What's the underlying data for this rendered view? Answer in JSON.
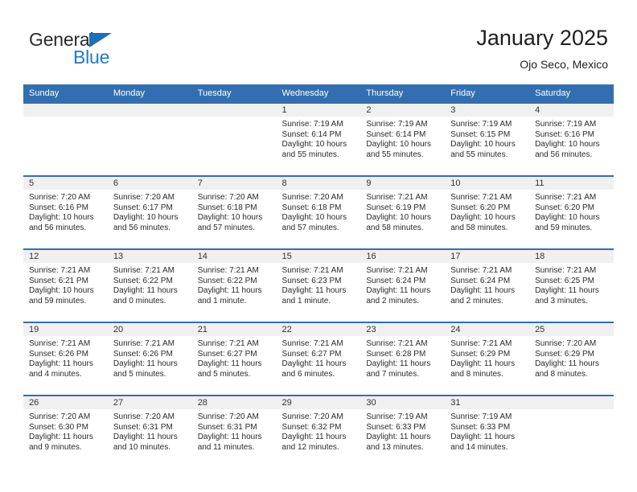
{
  "brand": {
    "name_top": "General",
    "name_bottom": "Blue",
    "triangle_color": "#1f6fb5",
    "text_color": "#2b2b2b",
    "blue_color": "#2079c7"
  },
  "header": {
    "title": "January 2025",
    "subtitle": "Ojo Seco, Mexico"
  },
  "theme": {
    "header_blue": "#336fb0",
    "daynum_band": "#f0f0f0",
    "text": "#2a2a2a"
  },
  "weekdays": [
    "Sunday",
    "Monday",
    "Tuesday",
    "Wednesday",
    "Thursday",
    "Friday",
    "Saturday"
  ],
  "weeks": [
    [
      {
        "day": "",
        "sunrise": "",
        "sunset": "",
        "daylight_line1": "",
        "daylight_line2": ""
      },
      {
        "day": "",
        "sunrise": "",
        "sunset": "",
        "daylight_line1": "",
        "daylight_line2": ""
      },
      {
        "day": "",
        "sunrise": "",
        "sunset": "",
        "daylight_line1": "",
        "daylight_line2": ""
      },
      {
        "day": "1",
        "sunrise": "Sunrise: 7:19 AM",
        "sunset": "Sunset: 6:14 PM",
        "daylight_line1": "Daylight: 10 hours",
        "daylight_line2": "and 55 minutes."
      },
      {
        "day": "2",
        "sunrise": "Sunrise: 7:19 AM",
        "sunset": "Sunset: 6:14 PM",
        "daylight_line1": "Daylight: 10 hours",
        "daylight_line2": "and 55 minutes."
      },
      {
        "day": "3",
        "sunrise": "Sunrise: 7:19 AM",
        "sunset": "Sunset: 6:15 PM",
        "daylight_line1": "Daylight: 10 hours",
        "daylight_line2": "and 55 minutes."
      },
      {
        "day": "4",
        "sunrise": "Sunrise: 7:19 AM",
        "sunset": "Sunset: 6:16 PM",
        "daylight_line1": "Daylight: 10 hours",
        "daylight_line2": "and 56 minutes."
      }
    ],
    [
      {
        "day": "5",
        "sunrise": "Sunrise: 7:20 AM",
        "sunset": "Sunset: 6:16 PM",
        "daylight_line1": "Daylight: 10 hours",
        "daylight_line2": "and 56 minutes."
      },
      {
        "day": "6",
        "sunrise": "Sunrise: 7:20 AM",
        "sunset": "Sunset: 6:17 PM",
        "daylight_line1": "Daylight: 10 hours",
        "daylight_line2": "and 56 minutes."
      },
      {
        "day": "7",
        "sunrise": "Sunrise: 7:20 AM",
        "sunset": "Sunset: 6:18 PM",
        "daylight_line1": "Daylight: 10 hours",
        "daylight_line2": "and 57 minutes."
      },
      {
        "day": "8",
        "sunrise": "Sunrise: 7:20 AM",
        "sunset": "Sunset: 6:18 PM",
        "daylight_line1": "Daylight: 10 hours",
        "daylight_line2": "and 57 minutes."
      },
      {
        "day": "9",
        "sunrise": "Sunrise: 7:21 AM",
        "sunset": "Sunset: 6:19 PM",
        "daylight_line1": "Daylight: 10 hours",
        "daylight_line2": "and 58 minutes."
      },
      {
        "day": "10",
        "sunrise": "Sunrise: 7:21 AM",
        "sunset": "Sunset: 6:20 PM",
        "daylight_line1": "Daylight: 10 hours",
        "daylight_line2": "and 58 minutes."
      },
      {
        "day": "11",
        "sunrise": "Sunrise: 7:21 AM",
        "sunset": "Sunset: 6:20 PM",
        "daylight_line1": "Daylight: 10 hours",
        "daylight_line2": "and 59 minutes."
      }
    ],
    [
      {
        "day": "12",
        "sunrise": "Sunrise: 7:21 AM",
        "sunset": "Sunset: 6:21 PM",
        "daylight_line1": "Daylight: 10 hours",
        "daylight_line2": "and 59 minutes."
      },
      {
        "day": "13",
        "sunrise": "Sunrise: 7:21 AM",
        "sunset": "Sunset: 6:22 PM",
        "daylight_line1": "Daylight: 11 hours",
        "daylight_line2": "and 0 minutes."
      },
      {
        "day": "14",
        "sunrise": "Sunrise: 7:21 AM",
        "sunset": "Sunset: 6:22 PM",
        "daylight_line1": "Daylight: 11 hours",
        "daylight_line2": "and 1 minute."
      },
      {
        "day": "15",
        "sunrise": "Sunrise: 7:21 AM",
        "sunset": "Sunset: 6:23 PM",
        "daylight_line1": "Daylight: 11 hours",
        "daylight_line2": "and 1 minute."
      },
      {
        "day": "16",
        "sunrise": "Sunrise: 7:21 AM",
        "sunset": "Sunset: 6:24 PM",
        "daylight_line1": "Daylight: 11 hours",
        "daylight_line2": "and 2 minutes."
      },
      {
        "day": "17",
        "sunrise": "Sunrise: 7:21 AM",
        "sunset": "Sunset: 6:24 PM",
        "daylight_line1": "Daylight: 11 hours",
        "daylight_line2": "and 2 minutes."
      },
      {
        "day": "18",
        "sunrise": "Sunrise: 7:21 AM",
        "sunset": "Sunset: 6:25 PM",
        "daylight_line1": "Daylight: 11 hours",
        "daylight_line2": "and 3 minutes."
      }
    ],
    [
      {
        "day": "19",
        "sunrise": "Sunrise: 7:21 AM",
        "sunset": "Sunset: 6:26 PM",
        "daylight_line1": "Daylight: 11 hours",
        "daylight_line2": "and 4 minutes."
      },
      {
        "day": "20",
        "sunrise": "Sunrise: 7:21 AM",
        "sunset": "Sunset: 6:26 PM",
        "daylight_line1": "Daylight: 11 hours",
        "daylight_line2": "and 5 minutes."
      },
      {
        "day": "21",
        "sunrise": "Sunrise: 7:21 AM",
        "sunset": "Sunset: 6:27 PM",
        "daylight_line1": "Daylight: 11 hours",
        "daylight_line2": "and 5 minutes."
      },
      {
        "day": "22",
        "sunrise": "Sunrise: 7:21 AM",
        "sunset": "Sunset: 6:27 PM",
        "daylight_line1": "Daylight: 11 hours",
        "daylight_line2": "and 6 minutes."
      },
      {
        "day": "23",
        "sunrise": "Sunrise: 7:21 AM",
        "sunset": "Sunset: 6:28 PM",
        "daylight_line1": "Daylight: 11 hours",
        "daylight_line2": "and 7 minutes."
      },
      {
        "day": "24",
        "sunrise": "Sunrise: 7:21 AM",
        "sunset": "Sunset: 6:29 PM",
        "daylight_line1": "Daylight: 11 hours",
        "daylight_line2": "and 8 minutes."
      },
      {
        "day": "25",
        "sunrise": "Sunrise: 7:20 AM",
        "sunset": "Sunset: 6:29 PM",
        "daylight_line1": "Daylight: 11 hours",
        "daylight_line2": "and 8 minutes."
      }
    ],
    [
      {
        "day": "26",
        "sunrise": "Sunrise: 7:20 AM",
        "sunset": "Sunset: 6:30 PM",
        "daylight_line1": "Daylight: 11 hours",
        "daylight_line2": "and 9 minutes."
      },
      {
        "day": "27",
        "sunrise": "Sunrise: 7:20 AM",
        "sunset": "Sunset: 6:31 PM",
        "daylight_line1": "Daylight: 11 hours",
        "daylight_line2": "and 10 minutes."
      },
      {
        "day": "28",
        "sunrise": "Sunrise: 7:20 AM",
        "sunset": "Sunset: 6:31 PM",
        "daylight_line1": "Daylight: 11 hours",
        "daylight_line2": "and 11 minutes."
      },
      {
        "day": "29",
        "sunrise": "Sunrise: 7:20 AM",
        "sunset": "Sunset: 6:32 PM",
        "daylight_line1": "Daylight: 11 hours",
        "daylight_line2": "and 12 minutes."
      },
      {
        "day": "30",
        "sunrise": "Sunrise: 7:19 AM",
        "sunset": "Sunset: 6:33 PM",
        "daylight_line1": "Daylight: 11 hours",
        "daylight_line2": "and 13 minutes."
      },
      {
        "day": "31",
        "sunrise": "Sunrise: 7:19 AM",
        "sunset": "Sunset: 6:33 PM",
        "daylight_line1": "Daylight: 11 hours",
        "daylight_line2": "and 14 minutes."
      },
      {
        "day": "",
        "sunrise": "",
        "sunset": "",
        "daylight_line1": "",
        "daylight_line2": ""
      }
    ]
  ]
}
